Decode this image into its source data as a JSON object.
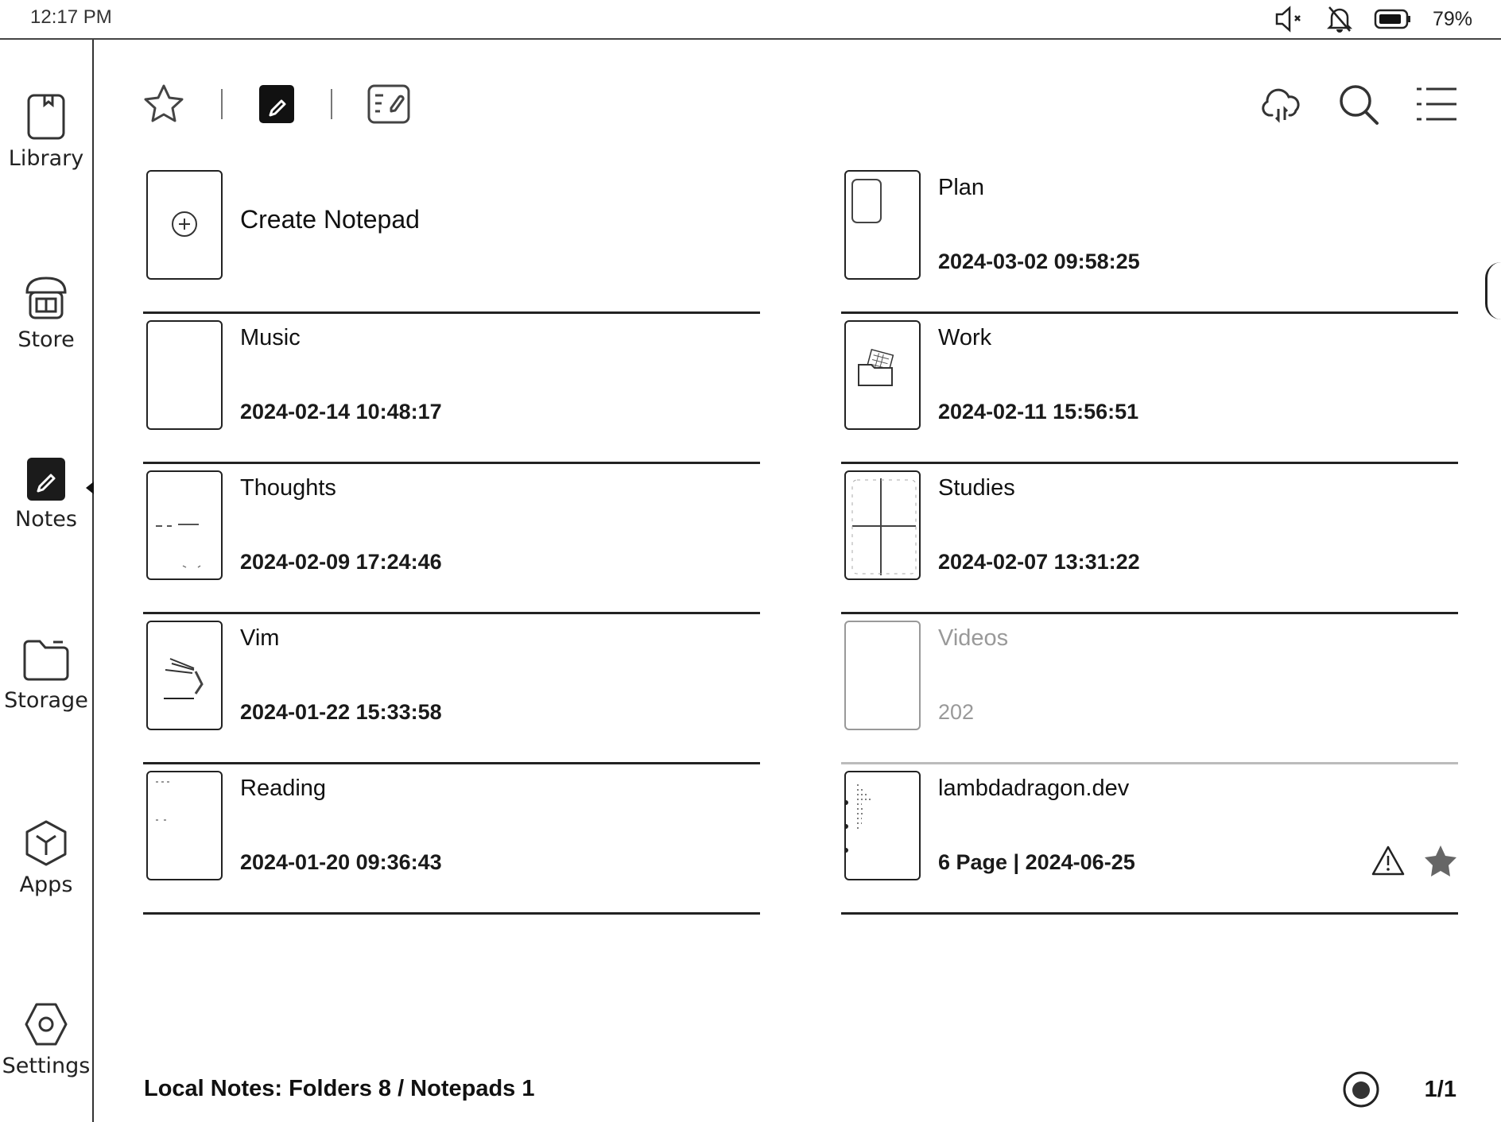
{
  "status_bar": {
    "time": "12:17 PM",
    "icons": [
      "mute-icon",
      "notifications-off-icon",
      "battery-icon"
    ],
    "battery_percent": "79%",
    "battery_level": 0.79
  },
  "sidebar": {
    "items": [
      {
        "label": "Library",
        "icon": "book-icon",
        "active": false
      },
      {
        "label": "Store",
        "icon": "store-icon",
        "active": false
      },
      {
        "label": "Notes",
        "icon": "notes-pen-icon",
        "active": true
      },
      {
        "label": "Storage",
        "icon": "folder-icon",
        "active": false
      },
      {
        "label": "Apps",
        "icon": "apps-cube-icon",
        "active": false
      },
      {
        "label": "Settings",
        "icon": "gear-hexagon-icon",
        "active": false
      }
    ]
  },
  "toolbar": {
    "left_tabs": [
      {
        "name": "favorites",
        "icon": "star-icon",
        "active": false
      },
      {
        "name": "notes",
        "icon": "pen-notebook-icon",
        "active": true
      },
      {
        "name": "templates",
        "icon": "list-pen-icon",
        "active": false
      }
    ],
    "right_actions": [
      {
        "name": "cloud-sync",
        "icon": "cloud-sync-icon"
      },
      {
        "name": "search",
        "icon": "search-icon"
      },
      {
        "name": "view-options",
        "icon": "list-menu-icon"
      }
    ]
  },
  "items": [
    {
      "type": "create",
      "title": "Create Notepad",
      "date": ""
    },
    {
      "type": "folder",
      "title": "Plan",
      "date": "2024-03-02 09:58:25"
    },
    {
      "type": "folder",
      "title": "Music",
      "date": "2024-02-14 10:48:17"
    },
    {
      "type": "folder",
      "title": "Work",
      "date": "2024-02-11 15:56:51"
    },
    {
      "type": "folder",
      "title": "Thoughts",
      "date": "2024-02-09 17:24:46"
    },
    {
      "type": "folder",
      "title": "Studies",
      "date": "2024-02-07 13:31:22"
    },
    {
      "type": "folder",
      "title": "Vim",
      "date": "2024-01-22 15:33:58"
    },
    {
      "type": "folder",
      "title": "Videos",
      "date": "202",
      "faded": true
    },
    {
      "type": "folder",
      "title": "Reading",
      "date": "2024-01-20 09:36:43"
    },
    {
      "type": "notepad",
      "title": "lambdadragon.dev",
      "date": "6 Page | 2024-06-25",
      "badges": [
        "warning-icon",
        "star-filled-icon"
      ]
    }
  ],
  "footer": {
    "summary": "Local Notes: Folders 8 / Notepads 1",
    "page": "1/1"
  }
}
